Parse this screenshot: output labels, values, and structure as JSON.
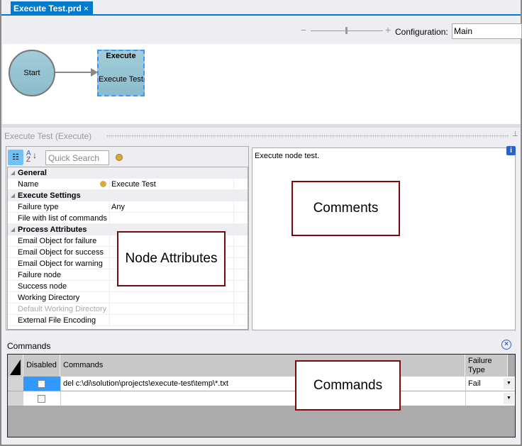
{
  "tab": {
    "title": "Execute Test.prd",
    "close_icon": "×"
  },
  "toolbar": {
    "zoom_minus": "−",
    "zoom_plus": "+",
    "configuration_label": "Configuration:",
    "configuration_value": "Main"
  },
  "diagram": {
    "start_label": "Start",
    "execute_type": "Execute",
    "execute_name": "Execute Test",
    "node_color": "#9ec8d6",
    "selection_color": "#3399ff"
  },
  "panel": {
    "title": "Execute Test (Execute)",
    "pin_icon": "pin"
  },
  "properties": {
    "search_placeholder": "Quick Search",
    "sort_icon": "A\nZ↓",
    "categories": [
      {
        "label": "General",
        "items": [
          {
            "name": "Name",
            "value": "Execute Test"
          }
        ]
      },
      {
        "label": "Execute Settings",
        "items": [
          {
            "name": "Failure type",
            "value": "Any"
          },
          {
            "name": "File with list of commands",
            "value": ""
          }
        ]
      },
      {
        "label": "Process Attributes",
        "items": [
          {
            "name": "Email Object for failure",
            "value": ""
          },
          {
            "name": "Email Object for success",
            "value": ""
          },
          {
            "name": "Email Object for warning",
            "value": ""
          },
          {
            "name": "Failure node",
            "value": ""
          },
          {
            "name": "Success node",
            "value": ""
          },
          {
            "name": "Working Directory",
            "value": ""
          },
          {
            "name": "Default Working Directory",
            "value": "",
            "disabled": true
          },
          {
            "name": "External File Encoding",
            "value": ""
          }
        ]
      }
    ]
  },
  "comments": {
    "text": "Execute node test.",
    "info_icon": "i"
  },
  "commands": {
    "label": "Commands",
    "close_icon": "×",
    "columns": [
      "Disabled",
      "Commands",
      "Failure Type"
    ],
    "rows": [
      {
        "disabled": false,
        "command": "del c:\\di\\solution\\projects\\execute-test\\temp\\*.txt",
        "failure_type": "Fail"
      },
      {
        "disabled": false,
        "command": "",
        "failure_type": ""
      }
    ]
  },
  "annotations": {
    "node_attributes": "Node Attributes",
    "comments": "Comments",
    "commands": "Commands"
  }
}
